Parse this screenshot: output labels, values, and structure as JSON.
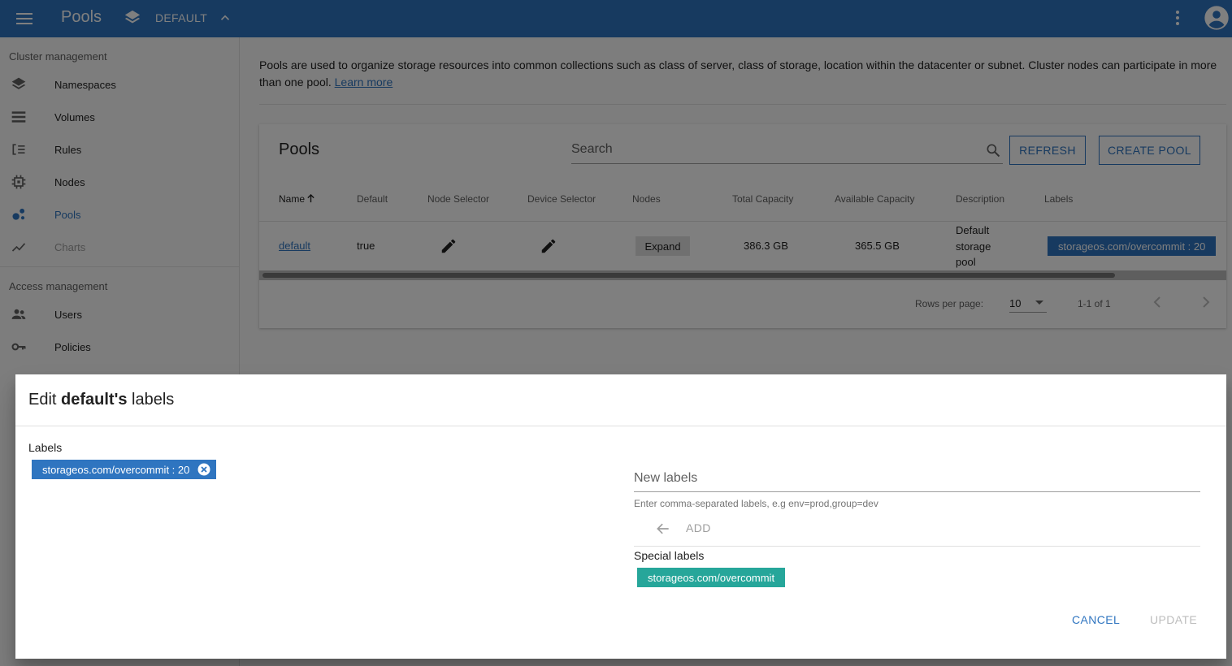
{
  "topbar": {
    "title": "Pools",
    "namespace": "DEFAULT",
    "menu_icon": "menu-icon",
    "namespace_icon": "layers-icon",
    "expand_icon": "chevron-up-icon",
    "more_icon": "more-vert-icon",
    "account_icon": "account-circle-icon"
  },
  "sidebar": {
    "cluster_section": "Cluster management",
    "cluster_items": [
      {
        "label": "Namespaces",
        "icon": "layers-icon"
      },
      {
        "label": "Volumes",
        "icon": "storage-icon"
      },
      {
        "label": "Rules",
        "icon": "rules-icon"
      },
      {
        "label": "Nodes",
        "icon": "chip-icon"
      },
      {
        "label": "Pools",
        "icon": "bubbles-icon",
        "active": true
      },
      {
        "label": "Charts",
        "icon": "chart-line-icon",
        "disabled": true
      }
    ],
    "access_section": "Access management",
    "access_items": [
      {
        "label": "Users",
        "icon": "people-icon"
      },
      {
        "label": "Policies",
        "icon": "key-icon"
      }
    ]
  },
  "main": {
    "intro_text": "Pools are used to organize storage resources into common collections such as class of server, class of storage, location within the datacenter or subnet. Cluster nodes can participate in more than one pool.",
    "learn_more": "Learn more",
    "card_title": "Pools",
    "search_placeholder": "Search",
    "refresh_label": "REFRESH",
    "create_label": "CREATE POOL",
    "columns": [
      "Name",
      "Default",
      "Node Selector",
      "Device Selector",
      "Nodes",
      "Total Capacity",
      "Available Capacity",
      "Description",
      "Labels"
    ],
    "rows": [
      {
        "name": "default",
        "default": "true",
        "nodes_button": "Expand",
        "total_capacity": "386.3 GB",
        "available_capacity": "365.5 GB",
        "description": "Default storage pool",
        "label": "storageos.com/overcommit : 20"
      }
    ],
    "pager": {
      "rows_per_page_label": "Rows per page:",
      "rows_per_page_value": "10",
      "range": "1-1 of 1"
    }
  },
  "dialog": {
    "title_prefix": "Edit ",
    "title_bold": "default's",
    "title_suffix": " labels",
    "labels_heading": "Labels",
    "current_label": "storageos.com/overcommit : 20",
    "new_labels_placeholder": "New labels",
    "helper_text": "Enter comma-separated labels, e.g env=prod,group=dev",
    "add_label": "ADD",
    "special_heading": "Special labels",
    "special_label": "storageos.com/overcommit",
    "cancel_label": "CANCEL",
    "update_label": "UPDATE"
  },
  "colors": {
    "primary": "#2f75c0",
    "teal": "#26a69a",
    "disabled": "#bdbdbd"
  }
}
